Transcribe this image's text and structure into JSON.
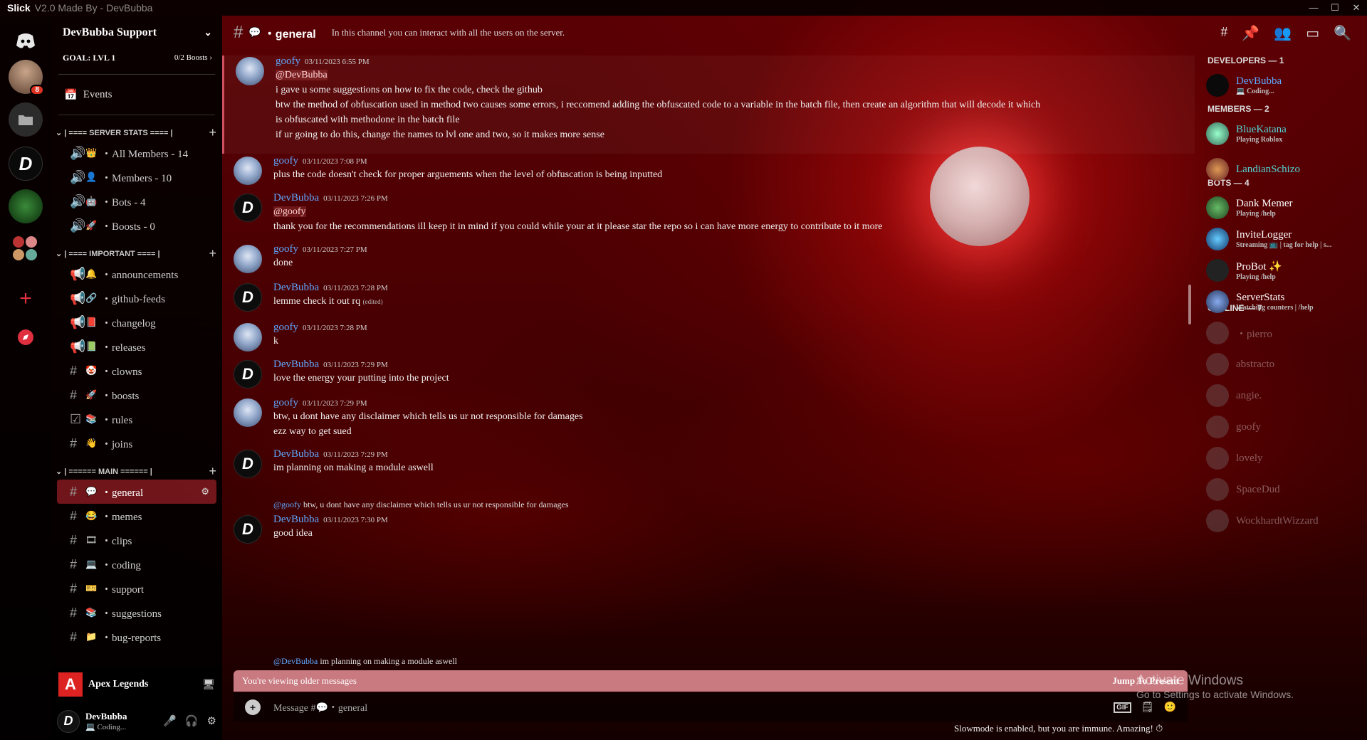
{
  "titlebar": {
    "app": "Slick",
    "subtitle": "V2.0 Made By - DevBubba",
    "minimize": "—",
    "maximize": "☐",
    "close": "✕"
  },
  "guilds": {
    "badge": "8"
  },
  "server": {
    "name": "DevBubba Support",
    "goal": "GOAL: LVL 1",
    "boosts": "0/2 Boosts",
    "events": "Events"
  },
  "categories": {
    "stats": "| ==== SERVER STATS ==== |",
    "important": "| ==== IMPORTANT ==== |",
    "main": "| ====== MAIN ====== |"
  },
  "stats_channels": [
    {
      "emoji": "👑",
      "name": "・All Members - 14"
    },
    {
      "emoji": "👤",
      "name": "・Members - 10"
    },
    {
      "emoji": "🤖",
      "name": "・Bots - 4"
    },
    {
      "emoji": "🚀",
      "name": "・Boosts - 0"
    }
  ],
  "important_channels": [
    {
      "emoji": "🔔",
      "name": "・announcements"
    },
    {
      "emoji": "🔗",
      "name": "・github-feeds"
    },
    {
      "emoji": "📕",
      "name": "・changelog"
    },
    {
      "emoji": "📗",
      "name": "・releases"
    },
    {
      "emoji": "🤡",
      "name": "・clowns"
    },
    {
      "emoji": "🚀",
      "name": "・boosts"
    },
    {
      "emoji": "📚",
      "name": "・rules"
    },
    {
      "emoji": "👋",
      "name": "・joins"
    }
  ],
  "main_channels": [
    {
      "emoji": "💬",
      "name": "・general"
    },
    {
      "emoji": "😂",
      "name": "・memes"
    },
    {
      "emoji": "🎞",
      "name": "・clips"
    },
    {
      "emoji": "💻",
      "name": "・coding"
    },
    {
      "emoji": "🎫",
      "name": "・support"
    },
    {
      "emoji": "📚",
      "name": "・suggestions"
    },
    {
      "emoji": "📁",
      "name": "・bug-reports"
    }
  ],
  "activity": {
    "name": "Apex Legends",
    "logo": "A"
  },
  "user": {
    "name": "DevBubba",
    "status": "💻 Coding...",
    "avatar": "D"
  },
  "channel": {
    "name": "・general",
    "topic": "In this channel you can interact with all the users on the server."
  },
  "messages": [
    {
      "author": "goofy",
      "time": "03/11/2023 6:55 PM",
      "lines": [
        "@DevBubba",
        "i gave u some suggestions on how to fix the code, check the github",
        "btw the method of obfuscation used in method two causes some errors, i reccomend adding the obfuscated code to a variable in the batch file, then create an algorithm that will decode it which",
        "is obfuscated with methodone in the batch file",
        "if ur going to do this, change the names to lvl one and two, so it makes more sense"
      ]
    },
    {
      "author": "goofy",
      "time": "03/11/2023 7:08 PM",
      "lines": [
        "plus the code doesn't check for proper arguements when the level of obfuscation is being inputted"
      ]
    },
    {
      "author": "DevBubba",
      "time": "03/11/2023 7:26 PM",
      "lines": [
        "@goofy",
        "thank you for the recommendations ill keep it in mind if you could while your at it please star the repo so i can have more energy to contribute to it more"
      ]
    },
    {
      "author": "goofy",
      "time": "03/11/2023 7:27 PM",
      "lines": [
        "done"
      ]
    },
    {
      "author": "DevBubba",
      "time": "03/11/2023 7:28 PM",
      "lines": [
        "lemme check it out rq"
      ],
      "edited": "(edited)"
    },
    {
      "author": "goofy",
      "time": "03/11/2023 7:28 PM",
      "lines": [
        "k"
      ]
    },
    {
      "author": "DevBubba",
      "time": "03/11/2023 7:29 PM",
      "lines": [
        "love the energy your putting into the project"
      ]
    },
    {
      "author": "goofy",
      "time": "03/11/2023 7:29 PM",
      "lines": [
        "btw, u dont have any disclaimer which tells us ur not responsible for damages",
        "ezz way to get sued"
      ]
    },
    {
      "author": "DevBubba",
      "time": "03/11/2023 7:29 PM",
      "lines": [
        "im planning on making a module aswell"
      ]
    },
    {
      "author": "DevBubba",
      "time": "03/11/2023 7:30 PM",
      "lines": [
        "good idea"
      ],
      "reply_to": "@goofy",
      "reply_text": "btw, u dont have any disclaimer which tells us ur not responsible for damages"
    }
  ],
  "last_reply": {
    "to": "@DevBubba",
    "text": "im planning on making a module aswell"
  },
  "older_bar": {
    "text": "You're viewing older messages",
    "jump": "Jump To Present"
  },
  "composer": {
    "placeholder": "Message #💬・general",
    "gif": "GIF"
  },
  "slowmode": "Slowmode is enabled, but you are immune. Amazing!",
  "watermark": {
    "line1": "Activate Windows",
    "line2": "Go to Settings to activate Windows."
  },
  "member_groups": {
    "developers": "DEVELOPERS — 1",
    "members": "MEMBERS — 2",
    "bots": "BOTS — 4",
    "offline": "OFFLINE — 7"
  },
  "developers": [
    {
      "name": "DevBubba",
      "status": "💻 Coding..."
    }
  ],
  "members": [
    {
      "name": "BlueKatana",
      "status": "Playing Roblox"
    },
    {
      "name": "LandianSchizo",
      "status": ""
    }
  ],
  "bots": [
    {
      "name": "Dank Memer",
      "status": "Playing /help"
    },
    {
      "name": "InviteLogger",
      "status": "Streaming 📺 | tag for help | s..."
    },
    {
      "name": "ProBot ✨",
      "status": "Playing /help"
    },
    {
      "name": "ServerStats",
      "status": "Watching counters | /help"
    }
  ],
  "offline": [
    "・pierro",
    "abstracto",
    "angie.",
    "goofy",
    "lovely",
    "SpaceDud",
    "WockhardtWizzard"
  ],
  "colors": {
    "accent": "#5fa8ff",
    "active_channel": "#c83240",
    "older_bar": "#c87a80"
  }
}
